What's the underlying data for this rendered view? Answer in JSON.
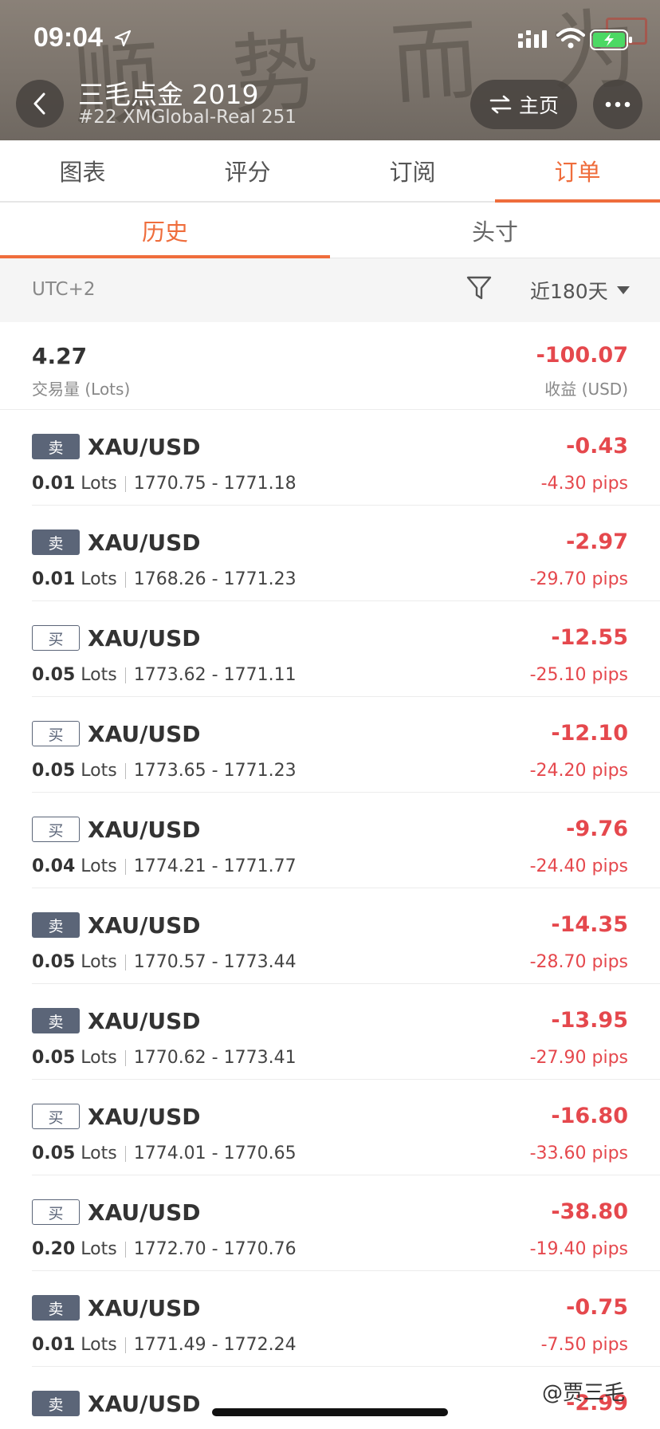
{
  "status_bar": {
    "time": "09:04"
  },
  "header": {
    "title": "三毛点金 2019",
    "subtitle": "#22 XMGlobal-Real 251",
    "home_label": "主页",
    "background_calligraphy": "顺势而为"
  },
  "tabs": [
    {
      "label": "图表",
      "active": false
    },
    {
      "label": "评分",
      "active": false
    },
    {
      "label": "订阅",
      "active": false
    },
    {
      "label": "订单",
      "active": true
    }
  ],
  "subtabs": [
    {
      "label": "历史",
      "active": true
    },
    {
      "label": "头寸",
      "active": false
    }
  ],
  "filter": {
    "timezone": "UTC+2",
    "range": "近180天"
  },
  "summary": {
    "volume": "4.27",
    "volume_label": "交易量 (Lots)",
    "profit": "-100.07",
    "profit_label": "收益 (USD)"
  },
  "orders": [
    {
      "side": "卖",
      "symbol": "XAU/USD",
      "lots": "0.01",
      "lots_unit": "Lots",
      "prices": "1770.75 - 1771.18",
      "profit": "-0.43",
      "pips": "-4.30 pips"
    },
    {
      "side": "卖",
      "symbol": "XAU/USD",
      "lots": "0.01",
      "lots_unit": "Lots",
      "prices": "1768.26 - 1771.23",
      "profit": "-2.97",
      "pips": "-29.70 pips"
    },
    {
      "side": "买",
      "symbol": "XAU/USD",
      "lots": "0.05",
      "lots_unit": "Lots",
      "prices": "1773.62 - 1771.11",
      "profit": "-12.55",
      "pips": "-25.10 pips"
    },
    {
      "side": "买",
      "symbol": "XAU/USD",
      "lots": "0.05",
      "lots_unit": "Lots",
      "prices": "1773.65 - 1771.23",
      "profit": "-12.10",
      "pips": "-24.20 pips"
    },
    {
      "side": "买",
      "symbol": "XAU/USD",
      "lots": "0.04",
      "lots_unit": "Lots",
      "prices": "1774.21 - 1771.77",
      "profit": "-9.76",
      "pips": "-24.40 pips"
    },
    {
      "side": "卖",
      "symbol": "XAU/USD",
      "lots": "0.05",
      "lots_unit": "Lots",
      "prices": "1770.57 - 1773.44",
      "profit": "-14.35",
      "pips": "-28.70 pips"
    },
    {
      "side": "卖",
      "symbol": "XAU/USD",
      "lots": "0.05",
      "lots_unit": "Lots",
      "prices": "1770.62 - 1773.41",
      "profit": "-13.95",
      "pips": "-27.90 pips"
    },
    {
      "side": "买",
      "symbol": "XAU/USD",
      "lots": "0.05",
      "lots_unit": "Lots",
      "prices": "1774.01 - 1770.65",
      "profit": "-16.80",
      "pips": "-33.60 pips"
    },
    {
      "side": "买",
      "symbol": "XAU/USD",
      "lots": "0.20",
      "lots_unit": "Lots",
      "prices": "1772.70 - 1770.76",
      "profit": "-38.80",
      "pips": "-19.40 pips"
    },
    {
      "side": "卖",
      "symbol": "XAU/USD",
      "lots": "0.01",
      "lots_unit": "Lots",
      "prices": "1771.49 - 1772.24",
      "profit": "-0.75",
      "pips": "-7.50 pips"
    },
    {
      "side": "卖",
      "symbol": "XAU/USD",
      "lots": "",
      "lots_unit": "",
      "prices": "",
      "profit": "-2.99",
      "pips": ""
    }
  ],
  "watermark": "@贾三毛",
  "colors": {
    "accent": "#ef6d3c",
    "loss": "#e5484d",
    "sell_badge": "#5b6578"
  },
  "icons": [
    "back-arrow-icon",
    "swap-arrows-icon",
    "more-dots-icon",
    "filter-funnel-icon",
    "caret-down-icon",
    "location-arrow-icon",
    "cellular-signal-icon",
    "wifi-icon",
    "battery-charging-icon"
  ]
}
